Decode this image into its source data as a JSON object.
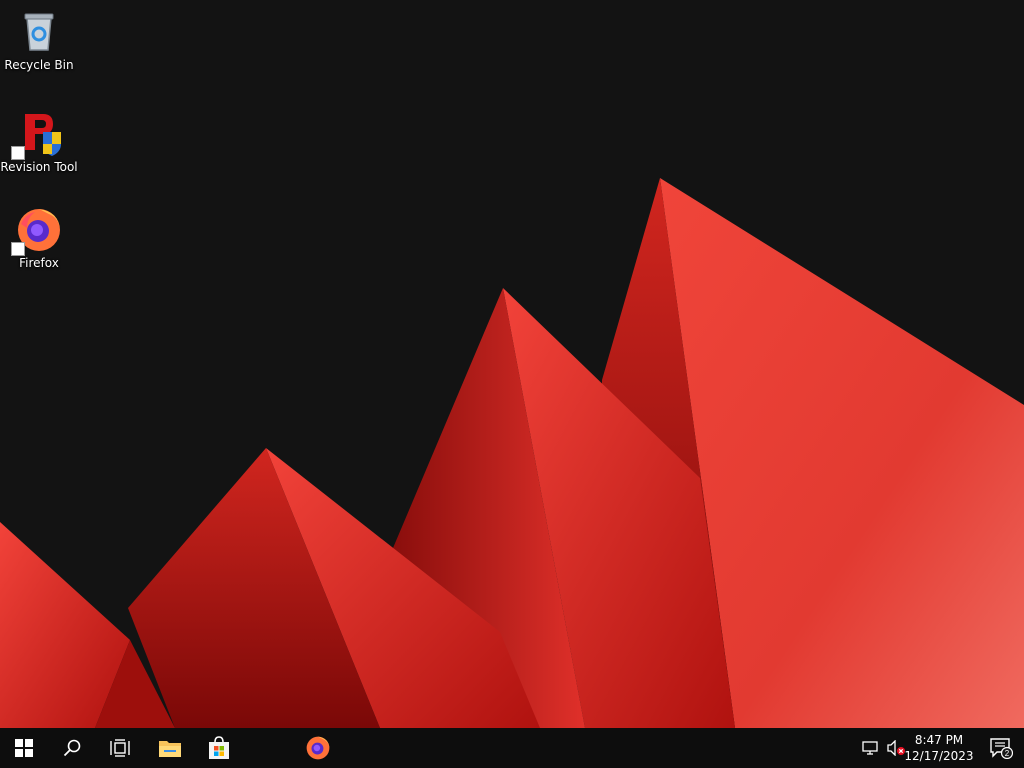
{
  "desktop": {
    "icons": [
      {
        "label": "Recycle Bin",
        "icon": "recycle-bin-icon"
      },
      {
        "label": "Revision Tool",
        "icon": "revision-tool-icon"
      },
      {
        "label": "Firefox",
        "icon": "firefox-icon"
      }
    ],
    "wallpaper": {
      "background": "#131313",
      "accent": "#e8312a"
    }
  },
  "taskbar": {
    "buttons": [
      {
        "name": "start",
        "icon": "windows-logo-icon"
      },
      {
        "name": "search",
        "icon": "search-icon"
      },
      {
        "name": "task-view",
        "icon": "task-view-icon"
      },
      {
        "name": "file-explorer",
        "icon": "folder-icon"
      },
      {
        "name": "microsoft-store",
        "icon": "store-icon"
      },
      {
        "name": "firefox",
        "icon": "firefox-icon"
      }
    ],
    "tray": {
      "network_icon": "network-disconnected-icon",
      "volume_icon": "volume-muted-icon",
      "time": "8:47 PM",
      "date": "12/17/2023",
      "notification_count": "2"
    },
    "background": "#0d0d0d"
  }
}
